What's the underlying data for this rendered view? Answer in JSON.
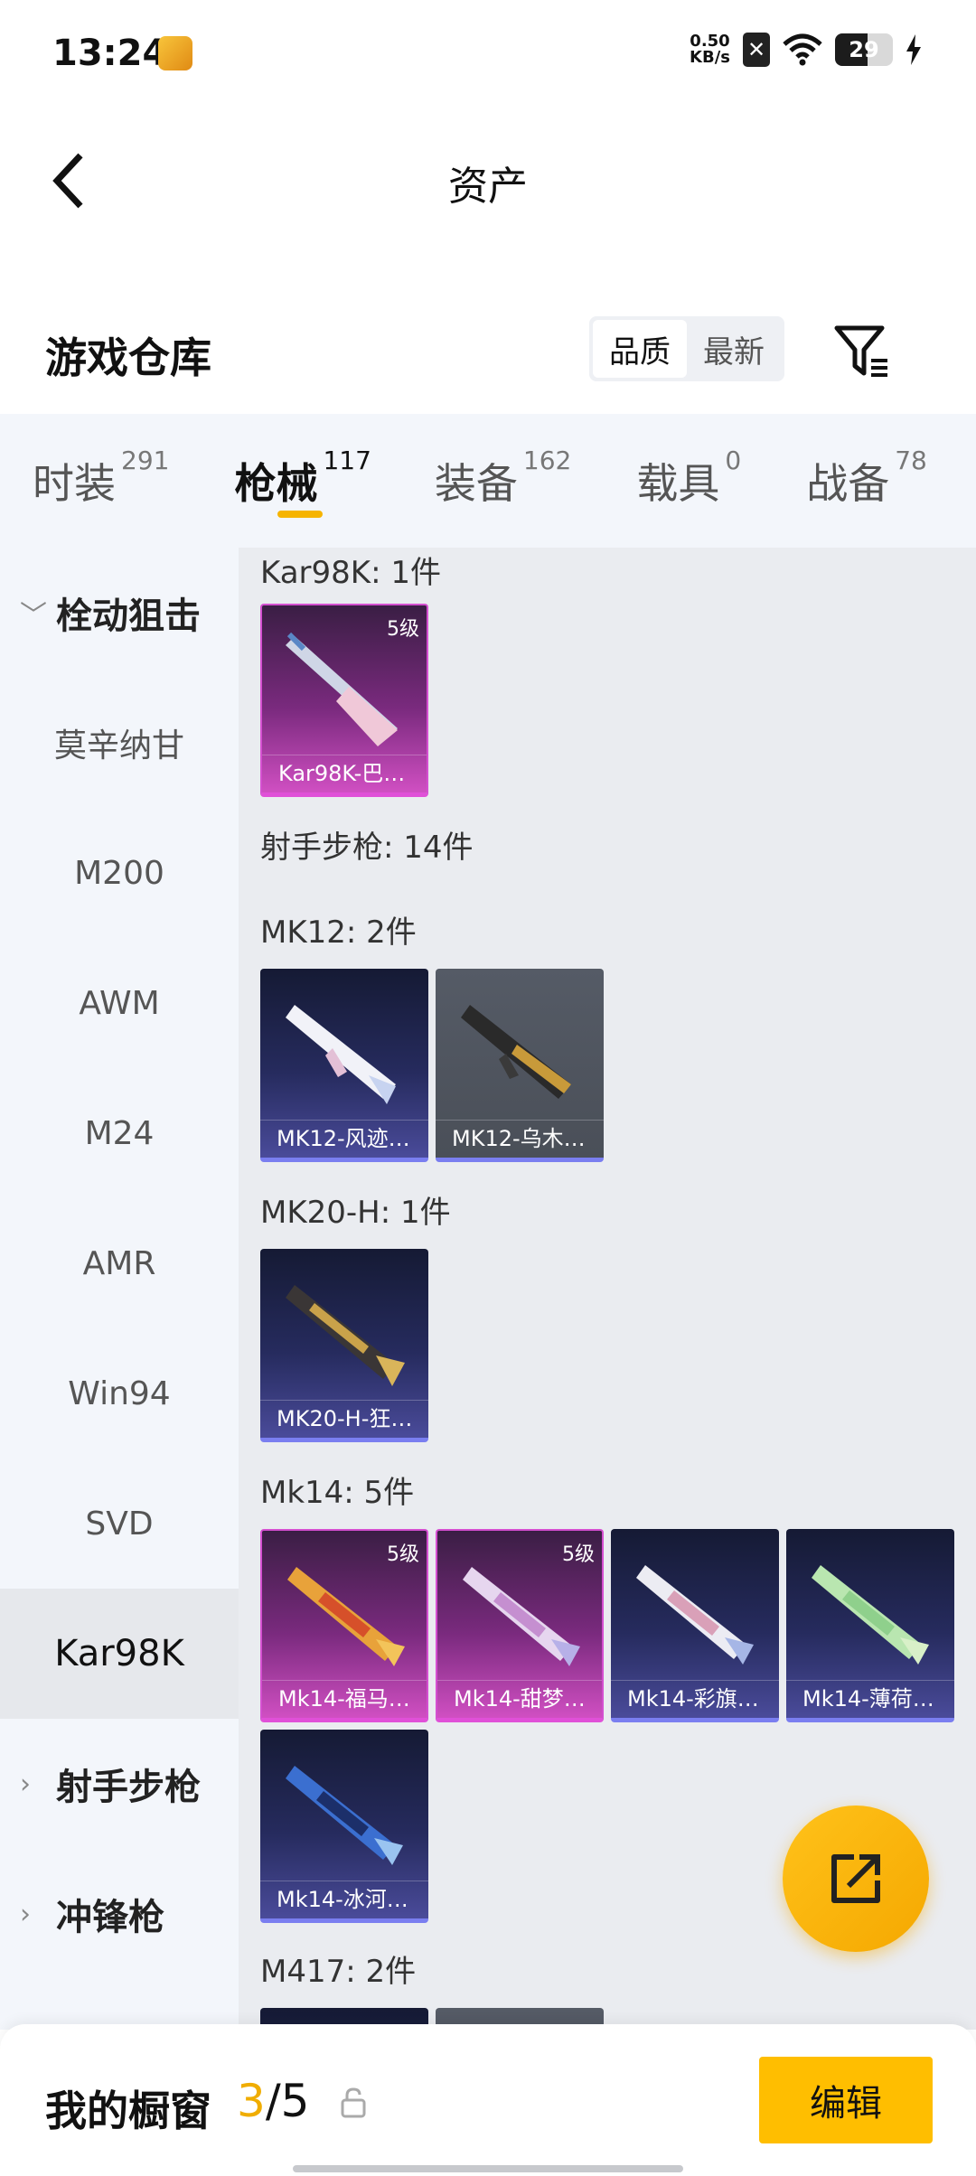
{
  "status_bar": {
    "time": "13:24",
    "net_speed_value": "0.50",
    "net_speed_unit": "KB/s",
    "battery": "29"
  },
  "header": {
    "title": "资产"
  },
  "warehouse": {
    "title": "游戏仓库",
    "sort_options": [
      "品质",
      "最新"
    ],
    "sort_active": "品质"
  },
  "category_tabs": [
    {
      "label": "时装",
      "count": "291"
    },
    {
      "label": "枪械",
      "count": "117"
    },
    {
      "label": "装备",
      "count": "162"
    },
    {
      "label": "载具",
      "count": "0"
    },
    {
      "label": "战备",
      "count": "78"
    }
  ],
  "sidebar": {
    "group_bolt": "栓动狙击",
    "items": [
      "莫辛纳甘",
      "M200",
      "AWM",
      "M24",
      "AMR",
      "Win94",
      "SVD",
      "Kar98K"
    ],
    "group_marksman": "射手步枪",
    "group_smg": "冲锋枪"
  },
  "content": {
    "kar98k_label": "Kar98K: 1件",
    "marksman_label": "射手步枪: 14件",
    "mk12_label": "MK12: 2件",
    "mk20_label": "MK20-H: 1件",
    "mk14_label": "Mk14: 5件",
    "m417_label": "M417: 2件",
    "cards": {
      "kar98k_1": {
        "name": "Kar98K-巴…",
        "level": "5级"
      },
      "mk12_1": {
        "name": "MK12-风迹…"
      },
      "mk12_2": {
        "name": "MK12-乌木…"
      },
      "mk20_1": {
        "name": "MK20-H-狂…"
      },
      "mk14_1": {
        "name": "Mk14-福马…",
        "level": "5级"
      },
      "mk14_2": {
        "name": "Mk14-甜梦…",
        "level": "5级"
      },
      "mk14_3": {
        "name": "Mk14-彩旗…"
      },
      "mk14_4": {
        "name": "Mk14-薄荷…"
      },
      "mk14_5": {
        "name": "Mk14-冰河…"
      }
    }
  },
  "bottom_bar": {
    "title": "我的橱窗",
    "current": "3",
    "separator": "/",
    "total": "5",
    "edit_label": "编辑"
  },
  "colors": {
    "accent": "#ffbe00",
    "legendary": "#d44fd0",
    "epic": "#7a7ef0"
  }
}
